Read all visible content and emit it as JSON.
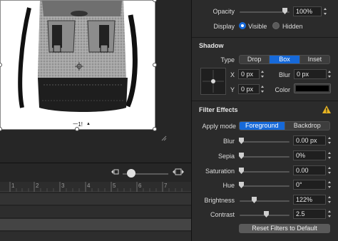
{
  "canvas": {
    "image_caption": "ㅡ1!",
    "page_marker": "▲"
  },
  "timeline": {
    "ruler_ticks": [
      "1",
      "2",
      "3",
      "4",
      "5",
      "6",
      "7"
    ]
  },
  "inspector": {
    "appearance": {
      "opacity_label": "Opacity",
      "opacity_value": "100%",
      "opacity_fraction": 1.0,
      "display_label": "Display",
      "display_options": [
        "Visible",
        "Hidden"
      ],
      "display_selected": "Visible"
    },
    "shadow": {
      "title": "Shadow",
      "type_label": "Type",
      "type_options": [
        "Drop",
        "Box",
        "Inset"
      ],
      "type_selected": "Box",
      "x_label": "X",
      "x_value": "0 px",
      "y_label": "Y",
      "y_value": "0 px",
      "blur_label": "Blur",
      "blur_value": "0 px",
      "color_label": "Color",
      "color_value": "#000000"
    },
    "filters": {
      "title": "Filter Effects",
      "apply_mode_label": "Apply mode",
      "apply_mode_options": [
        "Foreground",
        "Backdrop"
      ],
      "apply_mode_selected": "Foreground",
      "rows": [
        {
          "label": "Blur",
          "value": "0.00 px",
          "fraction": 0.0
        },
        {
          "label": "Sepia",
          "value": "0%",
          "fraction": 0.0
        },
        {
          "label": "Saturation",
          "value": "0.00",
          "fraction": 0.0
        },
        {
          "label": "Hue",
          "value": "0°",
          "fraction": 0.0
        },
        {
          "label": "Brightness",
          "value": "122%",
          "fraction": 0.28
        },
        {
          "label": "Contrast",
          "value": "2.5",
          "fraction": 0.5
        }
      ],
      "reset_label": "Reset Filters to Default"
    },
    "warning_icon": "warning-triangle-icon"
  }
}
